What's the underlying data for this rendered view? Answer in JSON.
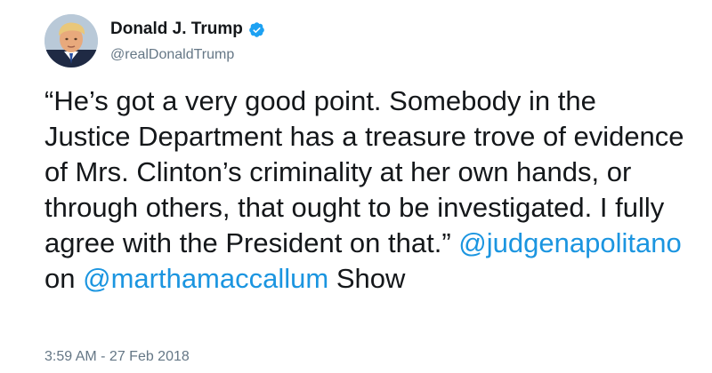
{
  "author": {
    "display_name": "Donald J. Trump",
    "handle": "@realDonaldTrump",
    "verified": true,
    "verified_badge_color": "#1da1f2"
  },
  "tweet": {
    "text_part1": "“He’s got a very good point. Somebody in the Justice Department has a treasure trove of evidence of Mrs. Clinton’s criminality at her own hands, or through others, that ought to be investigated. I fully agree with the President on that.”",
    "mention1": "@judgenapolitano",
    "text_part2": "on",
    "mention2": "@marthamaccallum",
    "text_part3": "Show",
    "mention_color": "#1b95e0"
  },
  "meta": {
    "timestamp": "3:59 AM - 27 Feb 2018"
  }
}
